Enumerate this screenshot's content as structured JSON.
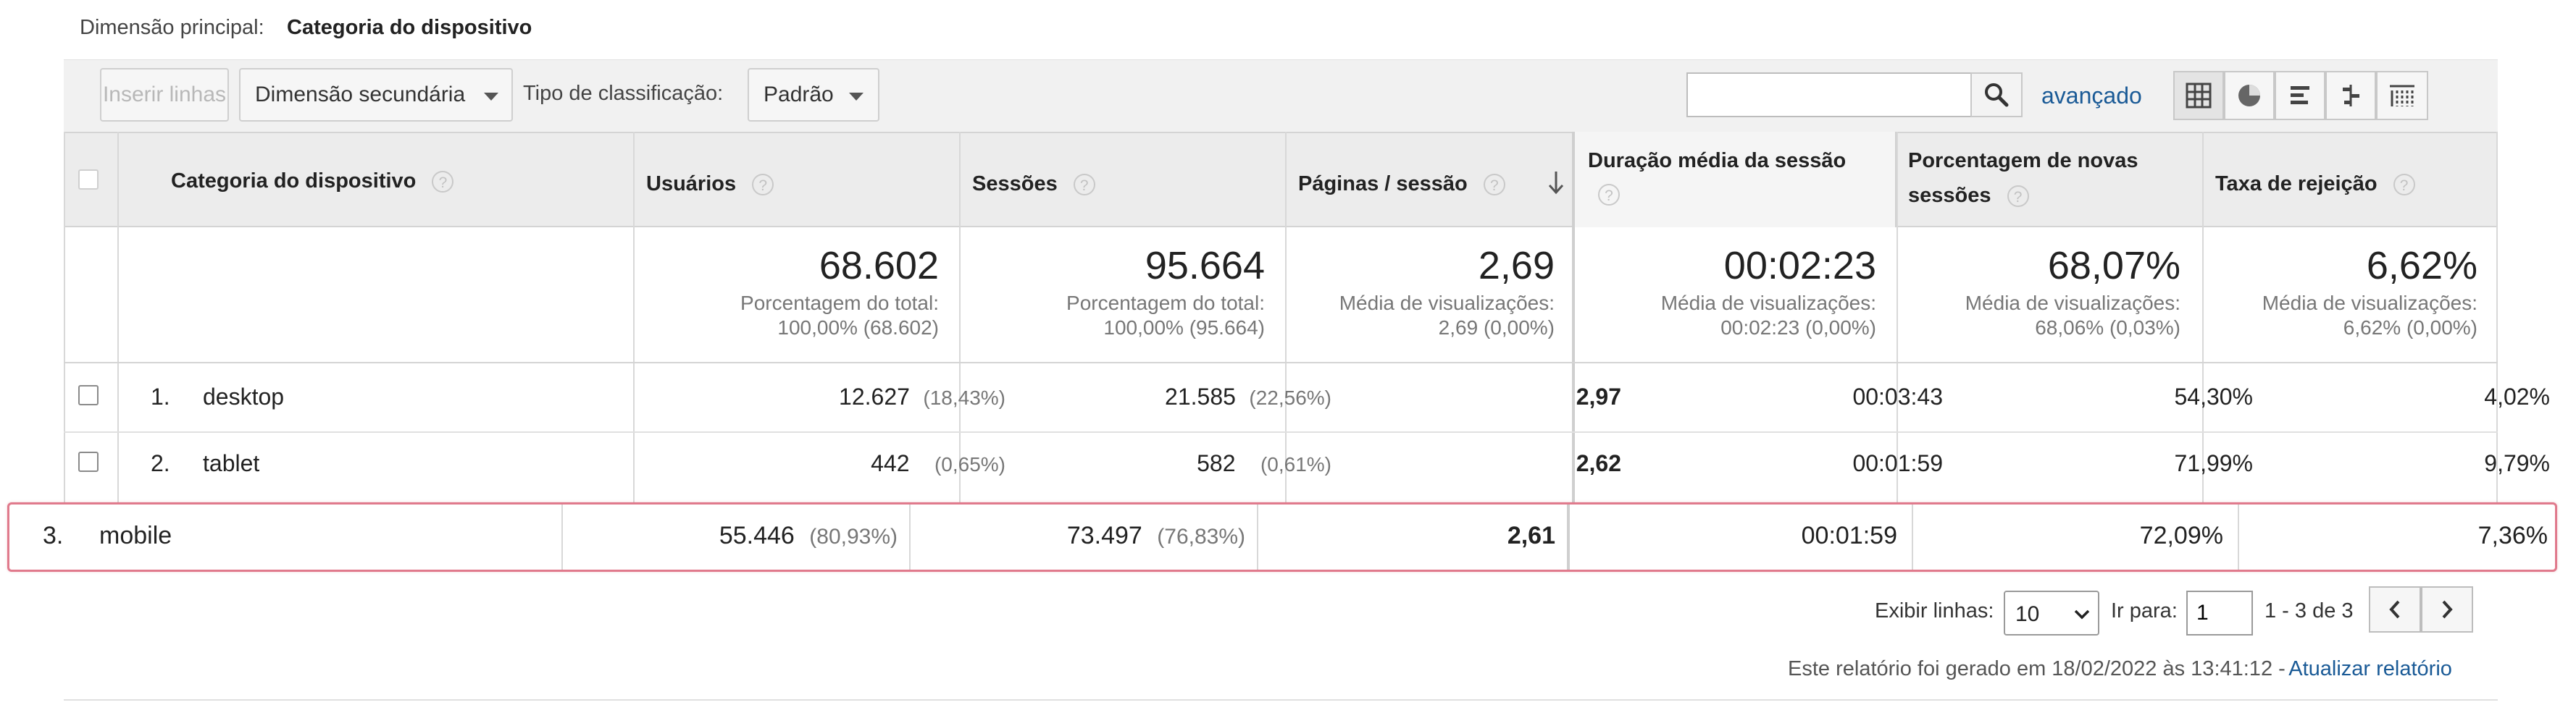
{
  "dimension": {
    "label": "Dimensão principal:",
    "value": "Categoria do dispositivo"
  },
  "toolbar": {
    "insert_rows": "Inserir linhas",
    "secondary_dimension": "Dimensão secundária",
    "sort_type_label": "Tipo de classificação:",
    "sort_type_value": "Padrão",
    "search_placeholder": "",
    "advanced": "avançado",
    "views": [
      "table-view-icon",
      "pie-view-icon",
      "bar-view-icon",
      "comparison-view-icon",
      "pivot-view-icon"
    ]
  },
  "table": {
    "headers": {
      "category": "Categoria do dispositivo",
      "users": "Usuários",
      "sessions": "Sessões",
      "pages_per_session": "Páginas / sessão",
      "avg_duration": "Duração média da sessão",
      "new_sessions_line1": "Porcentagem de novas",
      "new_sessions_line2": "sessões",
      "bounce_rate": "Taxa de rejeição"
    },
    "totals": {
      "users": "68.602",
      "users_sub1": "Porcentagem do total:",
      "users_sub2": "100,00% (68.602)",
      "sessions": "95.664",
      "sessions_sub1": "Porcentagem do total:",
      "sessions_sub2": "100,00% (95.664)",
      "pages": "2,69",
      "pages_sub1": "Média de visualizações:",
      "pages_sub2": "2,69 (0,00%)",
      "duration": "00:02:23",
      "duration_sub1": "Média de visualizações:",
      "duration_sub2": "00:02:23 (0,00%)",
      "new_sessions": "68,07%",
      "new_sessions_sub1": "Média de visualizações:",
      "new_sessions_sub2": "68,06% (0,03%)",
      "bounce": "6,62%",
      "bounce_sub1": "Média de visualizações:",
      "bounce_sub2": "6,62% (0,00%)"
    },
    "rows": [
      {
        "index": "1.",
        "category": "desktop",
        "users": "12.627",
        "users_pct": "(18,43%)",
        "sessions": "21.585",
        "sessions_pct": "(22,56%)",
        "pages": "2,97",
        "duration": "00:03:43",
        "new_sessions": "54,30%",
        "bounce": "4,02%"
      },
      {
        "index": "2.",
        "category": "tablet",
        "users": "442",
        "users_pct": "(0,65%)",
        "sessions": "582",
        "sessions_pct": "(0,61%)",
        "pages": "2,62",
        "duration": "00:01:59",
        "new_sessions": "71,99%",
        "bounce": "9,79%"
      },
      {
        "index": "3.",
        "category": "mobile",
        "users": "55.446",
        "users_pct": "(80,93%)",
        "sessions": "73.497",
        "sessions_pct": "(76,83%)",
        "pages": "2,61",
        "duration": "00:01:59",
        "new_sessions": "72,09%",
        "bounce": "7,36%"
      }
    ]
  },
  "pagination": {
    "show_rows_label": "Exibir linhas:",
    "show_rows_value": "10",
    "goto_label": "Ir para:",
    "goto_value": "1",
    "range": "1 - 3 de 3"
  },
  "footer": {
    "generated": "Este relatório foi gerado em 18/02/2022 às 13:41:12 -",
    "refresh": "Atualizar relatório"
  },
  "colors": {
    "link": "#1a5a96",
    "highlight_border": "#e07a8c",
    "header_bg": "#ececec"
  }
}
